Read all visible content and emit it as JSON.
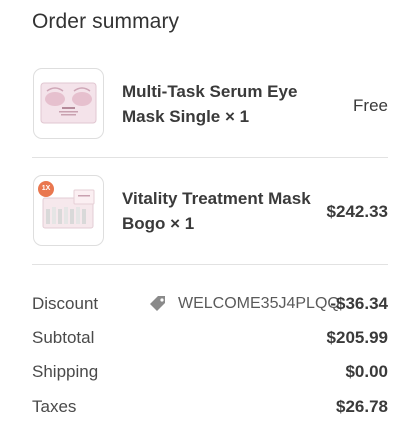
{
  "title": "Order summary",
  "items": [
    {
      "name": "Multi-Task Serum Eye Mask Single × 1",
      "price": "Free",
      "image_icon": "eye-mask-product-icon",
      "accent": "#e7c3cf"
    },
    {
      "name": "Vitality Treatment Mask Bogo × 1",
      "price": "$242.33",
      "image_icon": "treatment-mask-set-icon",
      "badge": "1X",
      "accent": "#f0d5dc"
    }
  ],
  "summary": {
    "discount": {
      "label": "Discount",
      "code": "WELCOME35J4PLQQ",
      "value": "-$36.34"
    },
    "subtotal": {
      "label": "Subtotal",
      "value": "$205.99"
    },
    "shipping": {
      "label": "Shipping",
      "value": "$0.00"
    },
    "taxes": {
      "label": "Taxes",
      "value": "$26.78"
    }
  },
  "colors": {
    "text": "#3a3a3a",
    "divider": "#e2e2e2",
    "tag_icon": "#8a8a8a",
    "badge": "#e9774f"
  }
}
